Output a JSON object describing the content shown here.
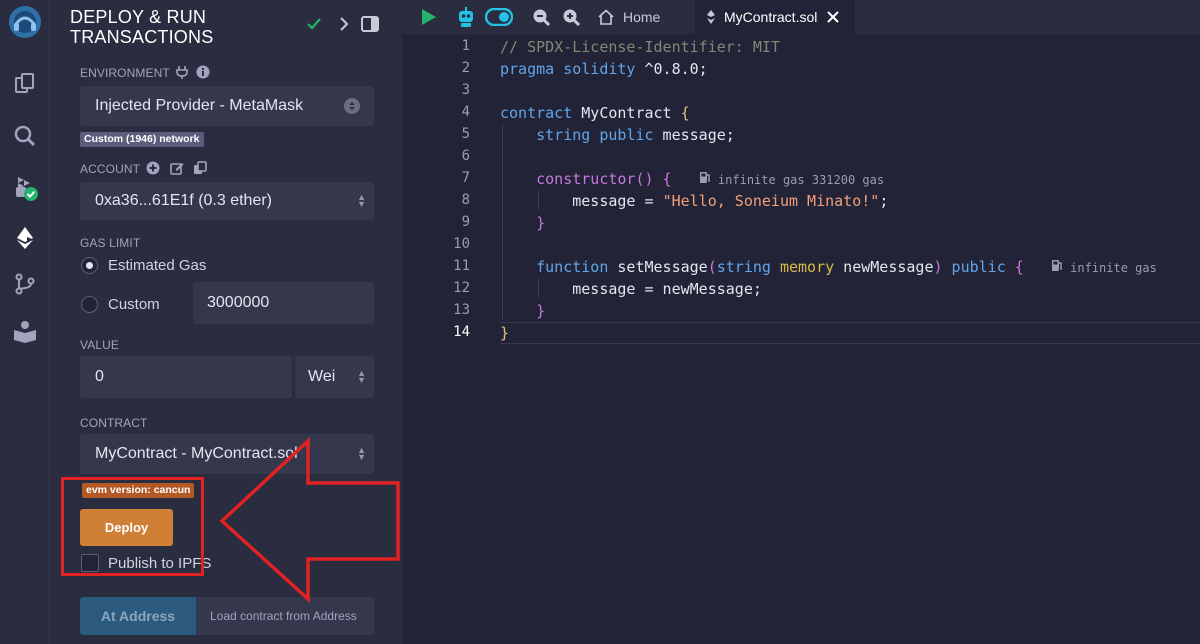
{
  "panel": {
    "title_line1": "DEPLOY & RUN",
    "title_line2": "TRANSACTIONS",
    "environment": {
      "label": "ENVIRONMENT",
      "value": "Injected Provider - MetaMask",
      "network_badge": "Custom (1946) network"
    },
    "account": {
      "label": "ACCOUNT",
      "value": "0xa36...61E1f (0.3 ether)"
    },
    "gas_limit": {
      "label": "GAS LIMIT",
      "estimated_label": "Estimated Gas",
      "custom_label": "Custom",
      "custom_value": "3000000"
    },
    "value": {
      "label": "VALUE",
      "amount": "0",
      "unit": "Wei"
    },
    "contract": {
      "label": "CONTRACT",
      "value": "MyContract - MyContract.sol",
      "evm_badge": "evm version: cancun"
    },
    "deploy_label": "Deploy",
    "publish_label": "Publish to IPFS",
    "at_address_label": "At Address",
    "load_contract_placeholder": "Load contract from Address"
  },
  "editor": {
    "home_tab": "Home",
    "file_tab": "MyContract.sol",
    "line_numbers": [
      "1",
      "2",
      "3",
      "4",
      "5",
      "6",
      "7",
      "8",
      "9",
      "10",
      "11",
      "12",
      "13",
      "14"
    ],
    "code": {
      "l1": "// SPDX-License-Identifier: MIT",
      "l2_kw": "pragma solidity",
      "l2_rest": " ^0.8.0;",
      "l4_kw": "contract",
      "l4_name": " MyContract ",
      "l4_brace": "{",
      "l5_type": "string",
      "l5_vis": " public",
      "l5_rest": " message;",
      "l7_fn": "constructor",
      "l7_paren": "()",
      "l7_brace": " {",
      "l7_hint": "infinite gas 331200 gas",
      "l8_a": "message = ",
      "l8_str": "\"Hello, Soneium Minato!\"",
      "l8_end": ";",
      "l9": "}",
      "l11_kw": "function",
      "l11_name": " setMessage",
      "l11_open": "(",
      "l11_type": "string",
      "l11_mem": " memory",
      "l11_param": " newMessage",
      "l11_close": ")",
      "l11_vis": " public",
      "l11_brace": " {",
      "l11_hint": "infinite gas",
      "l12": "message = newMessage;",
      "l13": "}",
      "l14": "}"
    }
  },
  "colors": {
    "deploy_button": "#d08036",
    "at_address_button": "#2c5a7e",
    "badge_network": "#5b5e7a",
    "badge_evm": "#b35925",
    "annotation": "#e02222",
    "run_icon": "#23b36b"
  }
}
